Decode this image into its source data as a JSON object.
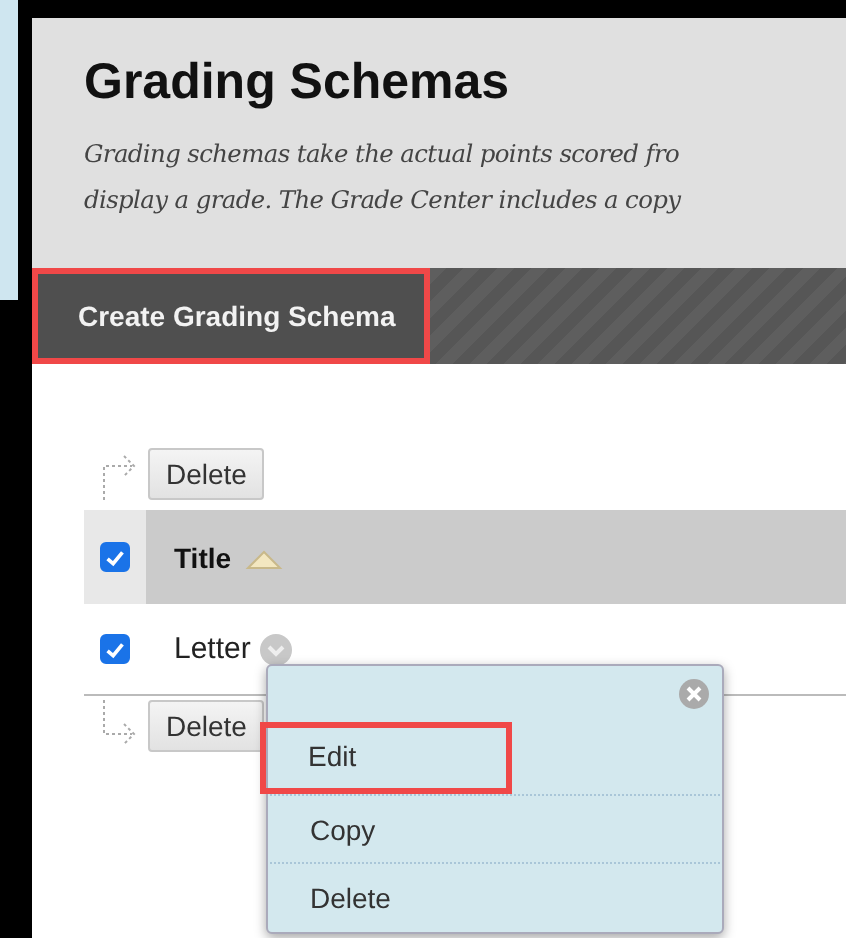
{
  "page": {
    "title": "Grading Schemas",
    "description_lines": [
      "Grading schemas take the actual points scored fro",
      "display a grade. The Grade Center includes a copy"
    ]
  },
  "action_bar": {
    "button": {
      "label": "Create Grading Schema",
      "highlighted": true
    }
  },
  "top_actions": {
    "button": "Delete"
  },
  "table": {
    "header": {
      "checked": true,
      "column": "Title"
    },
    "rows": [
      {
        "title": "Letter",
        "checked": true
      }
    ]
  },
  "bottom_actions": {
    "button": "Delete"
  },
  "context_menu": {
    "items": [
      {
        "label": "Edit",
        "highlighted": true
      },
      {
        "label": "Copy",
        "highlighted": false
      },
      {
        "label": "Delete",
        "highlighted": false
      }
    ]
  }
}
